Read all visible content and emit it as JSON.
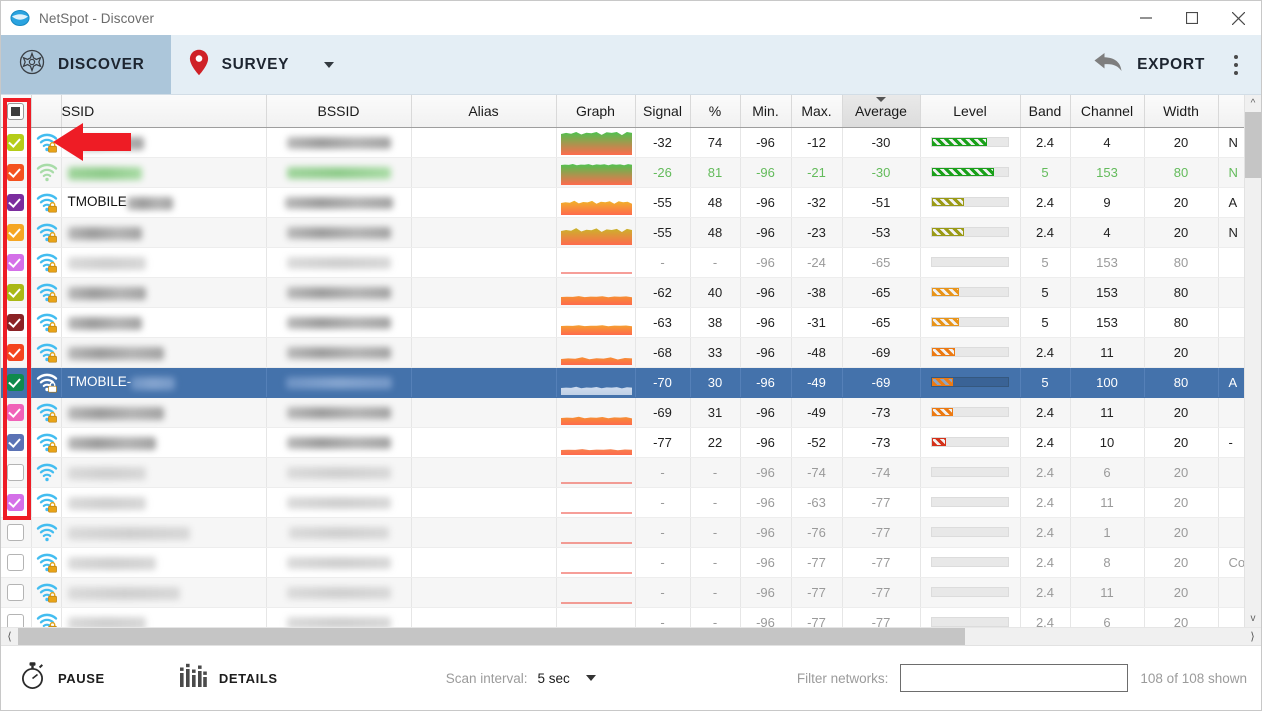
{
  "window": {
    "title": "NetSpot - Discover",
    "logo_icon": "netspot-logo-icon",
    "minimize_label": "Minimize",
    "maximize_label": "Maximize",
    "close_label": "Close"
  },
  "tabs": [
    {
      "id": "discover",
      "label": "DISCOVER",
      "icon": "discover-icon",
      "active": true
    },
    {
      "id": "survey",
      "label": "SURVEY",
      "icon": "map-pin-icon",
      "active": false
    }
  ],
  "toolbar": {
    "export_label": "EXPORT",
    "export_icon": "back-arrow-icon",
    "menu_icon": "kebab-menu-icon"
  },
  "table": {
    "columns": [
      {
        "key": "check",
        "label": "",
        "name": "select-all-column"
      },
      {
        "key": "lock",
        "label": "",
        "name": "security-column"
      },
      {
        "key": "ssid",
        "label": "SSID",
        "name": "ssid-column"
      },
      {
        "key": "bssid",
        "label": "BSSID",
        "name": "bssid-column"
      },
      {
        "key": "alias",
        "label": "Alias",
        "name": "alias-column"
      },
      {
        "key": "graph",
        "label": "Graph",
        "name": "graph-column"
      },
      {
        "key": "signal",
        "label": "Signal",
        "name": "signal-column"
      },
      {
        "key": "pct",
        "label": "%",
        "name": "percent-column"
      },
      {
        "key": "min",
        "label": "Min.",
        "name": "min-column"
      },
      {
        "key": "max",
        "label": "Max.",
        "name": "max-column"
      },
      {
        "key": "average",
        "label": "Average",
        "name": "average-column",
        "sorted": true
      },
      {
        "key": "level",
        "label": "Level",
        "name": "level-column"
      },
      {
        "key": "band",
        "label": "Band",
        "name": "band-column"
      },
      {
        "key": "channel",
        "label": "Channel",
        "name": "channel-column"
      },
      {
        "key": "width",
        "label": "Width",
        "name": "width-column"
      },
      {
        "key": "mode",
        "label": "",
        "name": "mode-column"
      }
    ],
    "rows": [
      {
        "checked": true,
        "check_color": "#b5cc18",
        "ssid_visible": "",
        "ssid_blur": 76,
        "bssid_blur": 104,
        "signal": "-32",
        "pct": "74",
        "min": "-96",
        "max": "-12",
        "average": "-30",
        "level_pct": 72,
        "level_color": "#1aa01a",
        "band": "2.4",
        "channel": "4",
        "width": "20",
        "mode": "N",
        "graph": "high",
        "dim": false,
        "green": false
      },
      {
        "checked": true,
        "check_color": "#f4511e",
        "ssid_visible": "",
        "ssid_blur": 74,
        "bssid_blur": 104,
        "signal": "-26",
        "pct": "81",
        "min": "-96",
        "max": "-21",
        "average": "-30",
        "level_pct": 82,
        "level_color": "#1aa01a",
        "band": "5",
        "channel": "153",
        "width": "80",
        "mode": "N",
        "graph": "high2",
        "dim": false,
        "green": true
      },
      {
        "checked": true,
        "check_color": "#7b2d9e",
        "ssid_visible": "TMOBILE",
        "ssid_blur": 46,
        "bssid_blur": 108,
        "signal": "-55",
        "pct": "48",
        "min": "-96",
        "max": "-32",
        "average": "-51",
        "level_pct": 42,
        "level_color": "#9a9a16",
        "band": "2.4",
        "channel": "9",
        "width": "20",
        "mode": "A",
        "graph": "mid",
        "dim": false,
        "green": false
      },
      {
        "checked": true,
        "check_color": "#f5a623",
        "ssid_visible": "",
        "ssid_blur": 74,
        "bssid_blur": 104,
        "signal": "-55",
        "pct": "48",
        "min": "-96",
        "max": "-23",
        "average": "-53",
        "level_pct": 42,
        "level_color": "#9a9a16",
        "band": "2.4",
        "channel": "4",
        "width": "20",
        "mode": "N",
        "graph": "mid2",
        "dim": false,
        "green": false
      },
      {
        "checked": true,
        "check_color": "#d470e8",
        "ssid_visible": "",
        "ssid_blur": 78,
        "bssid_blur": 104,
        "signal": "-",
        "pct": "-",
        "min": "-96",
        "max": "-24",
        "average": "-65",
        "level_pct": 0,
        "level_color": "#cccccc",
        "band": "5",
        "channel": "153",
        "width": "80",
        "mode": "",
        "graph": "flat",
        "dim": true,
        "green": false
      },
      {
        "checked": true,
        "check_color": "#aab815",
        "ssid_visible": "",
        "ssid_blur": 78,
        "bssid_blur": 104,
        "signal": "-62",
        "pct": "40",
        "min": "-96",
        "max": "-38",
        "average": "-65",
        "level_pct": 36,
        "level_color": "#e8941a",
        "band": "5",
        "channel": "153",
        "width": "80",
        "mode": "",
        "graph": "low",
        "dim": false,
        "green": false
      },
      {
        "checked": true,
        "check_color": "#8b2225",
        "ssid_visible": "",
        "ssid_blur": 74,
        "bssid_blur": 104,
        "signal": "-63",
        "pct": "38",
        "min": "-96",
        "max": "-31",
        "average": "-65",
        "level_pct": 36,
        "level_color": "#e8941a",
        "band": "5",
        "channel": "153",
        "width": "80",
        "mode": "",
        "graph": "low2",
        "dim": false,
        "green": false
      },
      {
        "checked": true,
        "check_color": "#f4441e",
        "ssid_visible": "",
        "ssid_blur": 96,
        "bssid_blur": 104,
        "signal": "-68",
        "pct": "33",
        "min": "-96",
        "max": "-48",
        "average": "-69",
        "level_pct": 30,
        "level_color": "#ec7a13",
        "band": "2.4",
        "channel": "11",
        "width": "20",
        "mode": "",
        "graph": "low3",
        "dim": false,
        "green": false
      },
      {
        "checked": true,
        "check_color": "#0f8a4d",
        "ssid_visible": "TMOBILE-",
        "ssid_blur": 44,
        "bssid_blur": 106,
        "signal": "-70",
        "pct": "30",
        "min": "-96",
        "max": "-49",
        "average": "-69",
        "level_pct": 28,
        "level_color": "#ec7a13",
        "band": "5",
        "channel": "100",
        "width": "80",
        "mode": "A",
        "graph": "sel",
        "dim": false,
        "green": false,
        "selected": true
      },
      {
        "checked": true,
        "check_color": "#f062b8",
        "ssid_visible": "",
        "ssid_blur": 96,
        "bssid_blur": 104,
        "signal": "-69",
        "pct": "31",
        "min": "-96",
        "max": "-49",
        "average": "-73",
        "level_pct": 28,
        "level_color": "#ec7a13",
        "band": "2.4",
        "channel": "11",
        "width": "20",
        "mode": "",
        "graph": "low4",
        "dim": false,
        "green": false
      },
      {
        "checked": true,
        "check_color": "#5b72b5",
        "ssid_visible": "",
        "ssid_blur": 88,
        "bssid_blur": 104,
        "signal": "-77",
        "pct": "22",
        "min": "-96",
        "max": "-52",
        "average": "-73",
        "level_pct": 18,
        "level_color": "#d4321a",
        "band": "2.4",
        "channel": "10",
        "width": "20",
        "mode": "-",
        "graph": "low5",
        "dim": false,
        "green": false
      },
      {
        "checked": false,
        "check_color": "",
        "ssid_visible": "",
        "ssid_blur": 78,
        "bssid_blur": 104,
        "signal": "-",
        "pct": "-",
        "min": "-96",
        "max": "-74",
        "average": "-74",
        "level_pct": 0,
        "level_color": "#cccccc",
        "band": "2.4",
        "channel": "6",
        "width": "20",
        "mode": "",
        "graph": "line",
        "dim": true,
        "green": false
      },
      {
        "checked": true,
        "check_color": "#d470e8",
        "ssid_visible": "",
        "ssid_blur": 78,
        "bssid_blur": 104,
        "signal": "-",
        "pct": "-",
        "min": "-96",
        "max": "-63",
        "average": "-77",
        "level_pct": 0,
        "level_color": "#cccccc",
        "band": "2.4",
        "channel": "11",
        "width": "20",
        "mode": "",
        "graph": "line",
        "dim": true,
        "green": false
      },
      {
        "checked": false,
        "check_color": "",
        "ssid_visible": "",
        "ssid_blur": 122,
        "bssid_blur": 100,
        "signal": "-",
        "pct": "-",
        "min": "-96",
        "max": "-76",
        "average": "-77",
        "level_pct": 0,
        "level_color": "#cccccc",
        "band": "2.4",
        "channel": "1",
        "width": "20",
        "mode": "",
        "graph": "line",
        "dim": true,
        "green": false
      },
      {
        "checked": false,
        "check_color": "",
        "ssid_visible": "",
        "ssid_blur": 88,
        "bssid_blur": 104,
        "signal": "-",
        "pct": "-",
        "min": "-96",
        "max": "-77",
        "average": "-77",
        "level_pct": 0,
        "level_color": "#cccccc",
        "band": "2.4",
        "channel": "8",
        "width": "20",
        "mode": "Co",
        "graph": "line",
        "dim": true,
        "green": false
      },
      {
        "checked": false,
        "check_color": "",
        "ssid_visible": "",
        "ssid_blur": 112,
        "bssid_blur": 104,
        "signal": "-",
        "pct": "-",
        "min": "-96",
        "max": "-77",
        "average": "-77",
        "level_pct": 0,
        "level_color": "#cccccc",
        "band": "2.4",
        "channel": "11",
        "width": "20",
        "mode": "",
        "graph": "line",
        "dim": true,
        "green": false
      },
      {
        "checked": false,
        "check_color": "",
        "ssid_visible": "",
        "ssid_blur": 78,
        "bssid_blur": 104,
        "signal": "-",
        "pct": "-",
        "min": "-96",
        "max": "-77",
        "average": "-77",
        "level_pct": 0,
        "level_color": "#cccccc",
        "band": "2.4",
        "channel": "6",
        "width": "20",
        "mode": "",
        "graph": "line",
        "dim": true,
        "green": false
      }
    ]
  },
  "statusbar": {
    "pause_label": "PAUSE",
    "pause_icon": "stopwatch-icon",
    "details_label": "DETAILS",
    "details_icon": "bar-levels-icon",
    "scan_interval_label": "Scan interval:",
    "scan_interval_value": "5 sec",
    "filter_label": "Filter networks:",
    "filter_value": "",
    "filter_placeholder": "",
    "shown_count": "108 of 108 shown"
  },
  "annotations": {
    "highlight_color": "#ee1c25",
    "arrow_name": "red-pointer-arrow",
    "rect_name": "red-highlight-rectangle"
  }
}
